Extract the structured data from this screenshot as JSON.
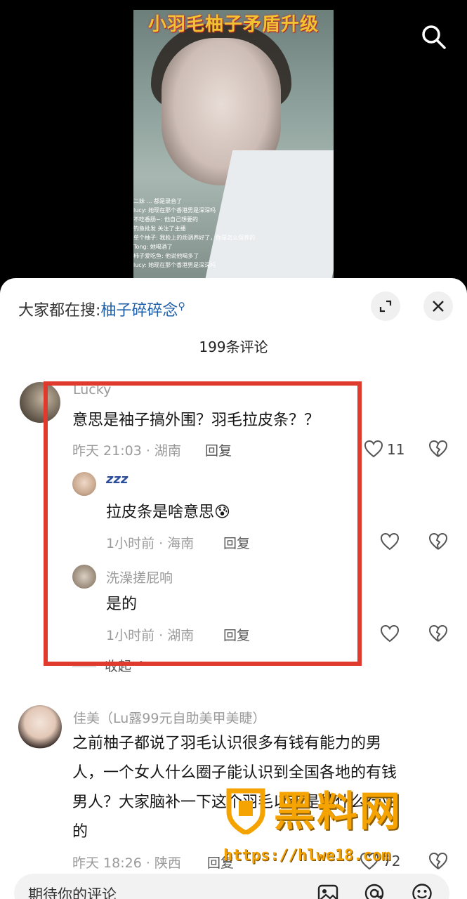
{
  "video": {
    "title_overlay": "小羽毛柚子矛盾升级",
    "live_comments": [
      "二妹 … 都是录音了",
      "lucy: 她现在那个香港男是深深吗",
      "不吃香肠~: 他自己想要的",
      "钓鱼批发 关注了主播",
      "单个柚子: 我脸上的烦调养好了，你是怎么保养的",
      "Tong: 她喝酒了",
      "柿子爱吃鱼: 他说他喝多了",
      "lucy: 她现在那个香港男是深深吗"
    ]
  },
  "icons": {
    "search": "search-icon",
    "expand": "expand-icon",
    "close": "close-icon",
    "heart": "heart-icon",
    "broken_heart": "broken-heart-icon",
    "image": "image-icon",
    "at": "at-icon",
    "emoji": "emoji-icon"
  },
  "sheet": {
    "search_prefix": "大家都在搜:",
    "search_keyword": "柚子碎碎念",
    "comment_count": "199条评论"
  },
  "comments": [
    {
      "user": "Lucky",
      "text": "意思是袖子搞外围？羽毛拉皮条？？",
      "meta": "昨天 21:03 · 湖南",
      "reply": "回复",
      "likes": "11",
      "replies": [
        {
          "user": "zzz",
          "text": "拉皮条是啥意思",
          "emoji": "😰",
          "meta": "1小时前 · 海南",
          "reply": "回复"
        },
        {
          "user": "洗澡搓屁响",
          "text": "是的",
          "meta": "1小时前 · 湖南",
          "reply": "回复"
        }
      ],
      "collapse": "收起"
    },
    {
      "user": "佳美（Lu露99元自助美甲美睫）",
      "text_lines": [
        "之前柚子都说了羽毛认识很多有钱有能力的男",
        "人，一个女人什么圈子能认识到全国各地的有钱",
        "男人？大家脑补一下这个羽毛以前是做什么行业",
        "的"
      ],
      "meta": "昨天 18:26 · 陕西",
      "reply": "回复",
      "likes": "72"
    }
  ],
  "input": {
    "placeholder": "期待你的评论"
  },
  "watermark": {
    "logo_text": "黑料网",
    "url": "https://hlwe18.com"
  },
  "colors": {
    "highlight": "#e03a2f",
    "watermark": "#f5a300",
    "keyword": "#1f5fa8"
  }
}
